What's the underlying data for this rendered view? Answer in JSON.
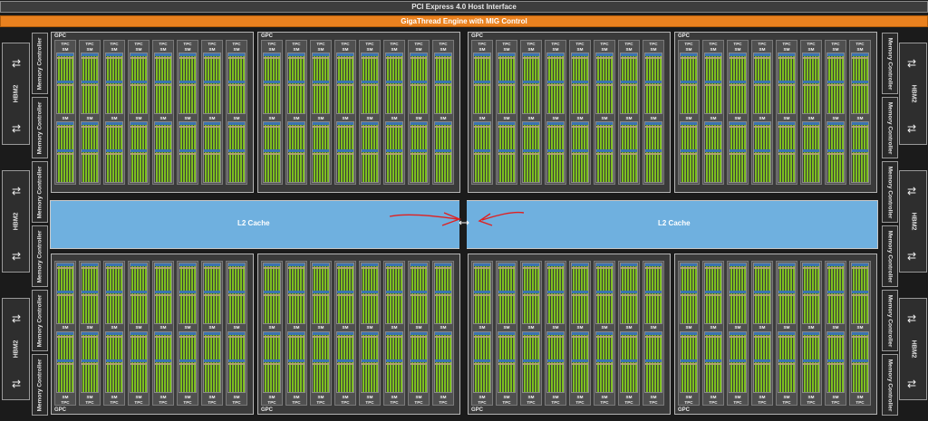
{
  "pcie": {
    "label": "PCI Express 4.0 Host Interface"
  },
  "gigathread": {
    "label": "GigaThread Engine with MIG Control"
  },
  "hbm": {
    "label": "HBM2"
  },
  "memory_controller": {
    "label": "Memory Controller"
  },
  "l2": {
    "left_label": "L2 Cache",
    "right_label": "L2 Cache"
  },
  "gpc": {
    "label": "GPC",
    "tpc_label": "TPC",
    "sm_label": "SM",
    "count": 8,
    "tpcs_per_gpc": 8,
    "sms_per_tpc": 2
  },
  "colors": {
    "pcie": "#3d3d3d",
    "gigathread": "#e9811f",
    "l2": "#6fb0df",
    "sm_cores": "#7dbf1f",
    "annotation": "#e02020"
  },
  "icons": {
    "hbm_link": "double-arrow-icon",
    "annotation": "red-hand-drawn-arrows"
  }
}
